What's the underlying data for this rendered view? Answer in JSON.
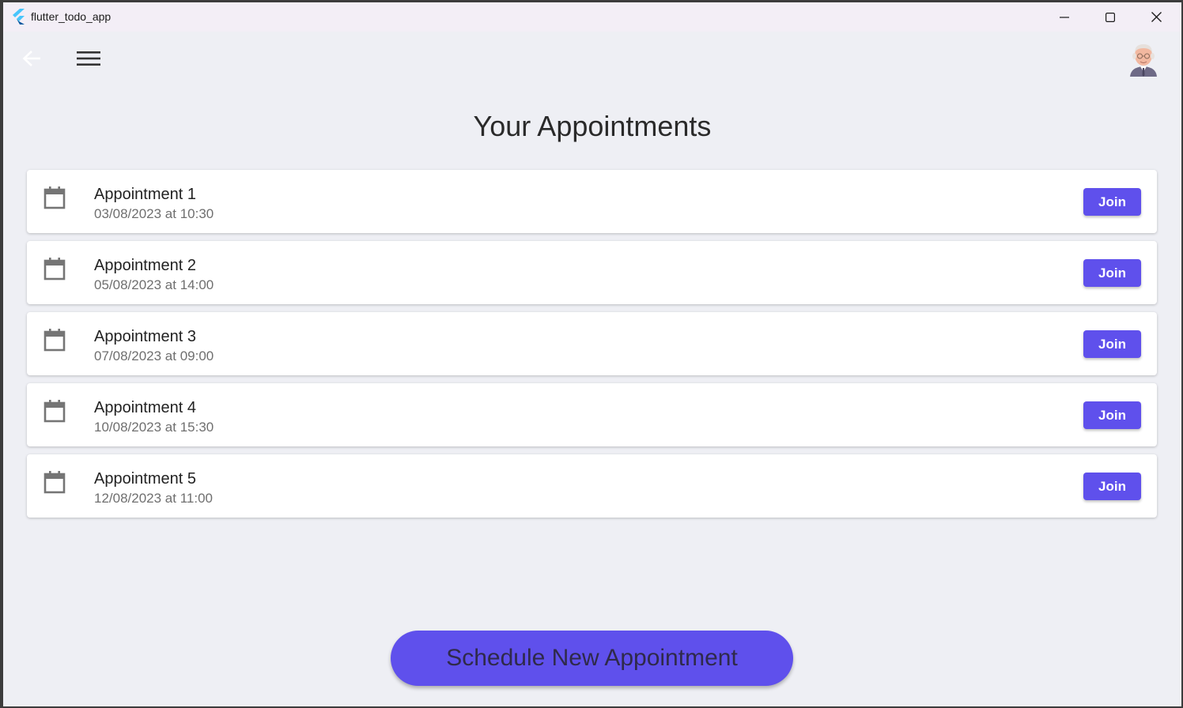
{
  "window": {
    "title": "flutter_todo_app",
    "controls": [
      "minimize-icon",
      "maximize-icon",
      "close-icon"
    ]
  },
  "toolbar": {
    "back_icon": "arrow-left-icon",
    "menu_icon": "hamburger-menu-icon",
    "avatar": "user-avatar"
  },
  "page": {
    "title": "Your Appointments"
  },
  "appointments": [
    {
      "title": "Appointment 1",
      "datetime": "03/08/2023 at 10:30",
      "action": "Join",
      "icon": "calendar-icon"
    },
    {
      "title": "Appointment 2",
      "datetime": "05/08/2023 at 14:00",
      "action": "Join",
      "icon": "calendar-icon"
    },
    {
      "title": "Appointment 3",
      "datetime": "07/08/2023 at 09:00",
      "action": "Join",
      "icon": "calendar-icon"
    },
    {
      "title": "Appointment 4",
      "datetime": "10/08/2023 at 15:30",
      "action": "Join",
      "icon": "calendar-icon"
    },
    {
      "title": "Appointment 5",
      "datetime": "12/08/2023 at 11:00",
      "action": "Join",
      "icon": "calendar-icon"
    }
  ],
  "schedule_button": {
    "label": "Schedule New Appointment"
  },
  "colors": {
    "primary": "#5f50ec",
    "background": "#eeeff4",
    "card": "#ffffff",
    "titlebar": "#f3eef6"
  }
}
